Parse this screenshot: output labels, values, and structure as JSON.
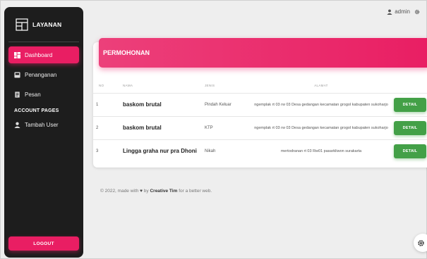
{
  "brand": {
    "title": "LAYANAN"
  },
  "sidebar": {
    "items": [
      {
        "label": "Dashboard",
        "icon": "dashboard-icon",
        "active": true
      },
      {
        "label": "Penanganan",
        "icon": "inbox-icon",
        "active": false
      },
      {
        "label": "Pesan",
        "icon": "receipt-icon",
        "active": false
      }
    ],
    "section_title": "ACCOUNT PAGES",
    "account_items": [
      {
        "label": "Tambah User",
        "icon": "person-icon"
      }
    ],
    "logout_label": "LOGOUT"
  },
  "topbar": {
    "user": "admin"
  },
  "card": {
    "title": "PERMOHONAN",
    "columns": [
      "NO",
      "NAMA",
      "JENIS",
      "ALAMAT"
    ],
    "rows": [
      {
        "no": "1",
        "nama": "baskom brutal",
        "jenis": "Pindah Keluar",
        "alamat": "ngemplak rt 03 rw 03 Desa gedangan kecamatan grogol kabupaten sukoharjo",
        "action": "DETAIL"
      },
      {
        "no": "2",
        "nama": "baskom brutal",
        "jenis": "KTP",
        "alamat": "ngemplak rt 03 rw 03 Desa gedangan kecamatan grogol kabupaten sukoharjo",
        "action": "DETAIL"
      },
      {
        "no": "3",
        "nama": "Lingga graha nur pra Dhoni",
        "jenis": "Nikah",
        "alamat": "mertodranan rt 03 Rw01 pasarkliwon surakarta",
        "action": "DETAIL"
      }
    ]
  },
  "footer": {
    "prefix": "© 2022, made with",
    "by": "by",
    "author": "Creative Tim",
    "suffix": "for a better web."
  },
  "colors": {
    "accent": "#e91e63",
    "success": "#43a047",
    "sidebar": "#1d1d1d"
  }
}
